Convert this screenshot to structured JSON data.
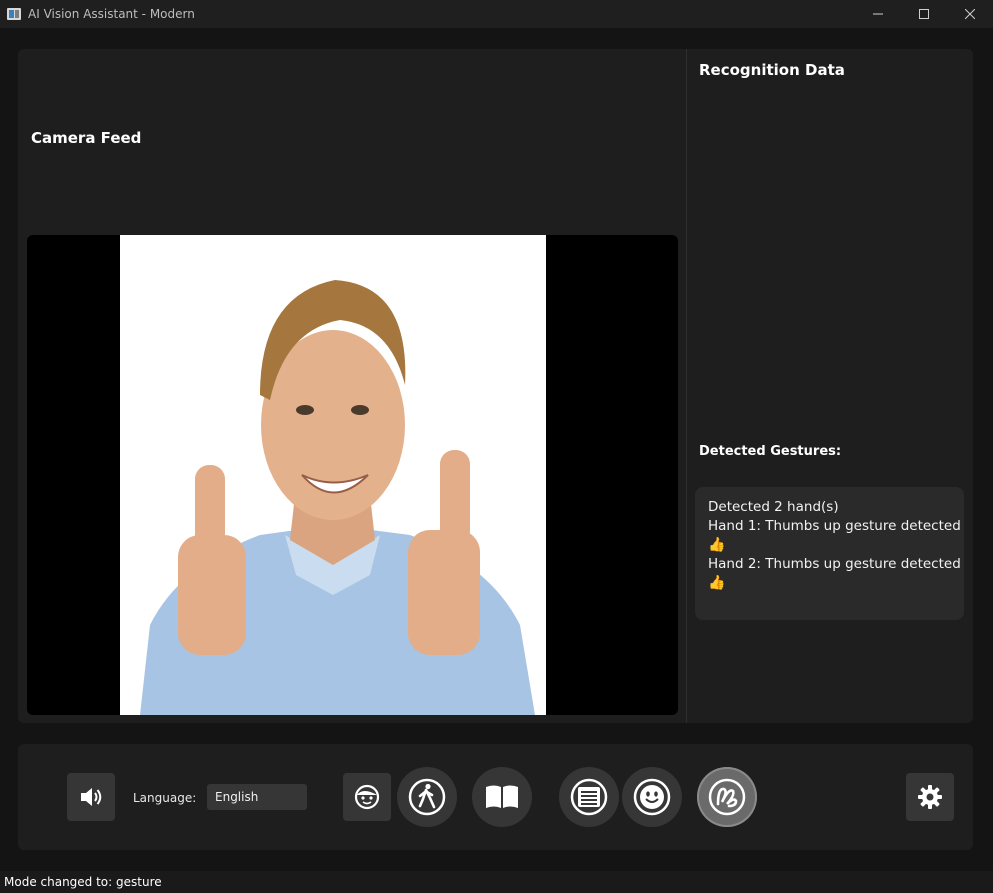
{
  "window": {
    "title": "AI Vision Assistant - Modern"
  },
  "camera": {
    "title": "Camera Feed"
  },
  "recognition": {
    "title": "Recognition Data",
    "gestures_title": "Detected Gestures:",
    "lines": [
      "Detected 2 hand(s)",
      "Hand 1: Thumbs up gesture detected",
      "👍",
      "Hand 2: Thumbs up gesture detected",
      "👍"
    ]
  },
  "controls": {
    "language_label": "Language:",
    "language_value": "English",
    "modes": [
      "face",
      "navigation",
      "reading",
      "text",
      "emotion",
      "gesture"
    ],
    "active_mode": "gesture"
  },
  "status": {
    "text": "Mode changed to: gesture"
  },
  "icons": {
    "app": "app-icon",
    "speaker": "speaker-icon",
    "settings": "gear-icon"
  },
  "colors": {
    "background": "#141414",
    "panel": "#1e1e1e",
    "button": "#363636",
    "active_button": "#6a6a6a"
  }
}
